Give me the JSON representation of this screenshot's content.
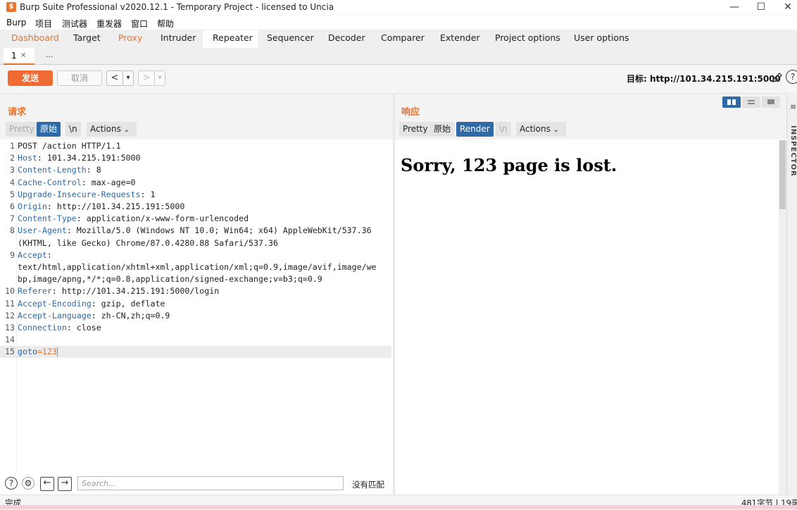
{
  "window": {
    "title": "Burp Suite Professional v2020.12.1 - Temporary Project - licensed to Uncia",
    "app_icon": "$"
  },
  "menu": [
    "Burp",
    "项目",
    "测试器",
    "重发器",
    "窗口",
    "帮助"
  ],
  "tabs": [
    {
      "label": "Dashboard",
      "state": "highlight"
    },
    {
      "label": "Target",
      "state": "normal"
    },
    {
      "label": "Proxy",
      "state": "highlight"
    },
    {
      "label": "Intruder",
      "state": "normal"
    },
    {
      "label": "Repeater",
      "state": "active"
    },
    {
      "label": "Sequencer",
      "state": "normal"
    },
    {
      "label": "Decoder",
      "state": "normal"
    },
    {
      "label": "Comparer",
      "state": "normal"
    },
    {
      "label": "Extender",
      "state": "normal"
    },
    {
      "label": "Project options",
      "state": "normal"
    },
    {
      "label": "User options",
      "state": "normal"
    }
  ],
  "subtabs": {
    "first": "1",
    "close": "×",
    "more": "..."
  },
  "toolbar": {
    "send": "发送",
    "cancel": "取消",
    "back": "<",
    "forward": ">",
    "dropdown": "▾",
    "target": "目标: http://101.34.215.191:5000"
  },
  "request": {
    "title": "请求",
    "buttons": {
      "pretty": "Pretty",
      "raw": "原始",
      "newline": "\\n",
      "actions": "Actions"
    },
    "lines": [
      {
        "n": "1",
        "key": "",
        "val": "POST /action HTTP/1.1"
      },
      {
        "n": "2",
        "key": "Host",
        "val": ": 101.34.215.191:5000"
      },
      {
        "n": "3",
        "key": "Content-Length",
        "val": ": 8"
      },
      {
        "n": "4",
        "key": "Cache-Control",
        "val": ": max-age=0"
      },
      {
        "n": "5",
        "key": "Upgrade-Insecure-Requests",
        "val": ": 1"
      },
      {
        "n": "6",
        "key": "Origin",
        "val": ": http://101.34.215.191:5000"
      },
      {
        "n": "7",
        "key": "Content-Type",
        "val": ": application/x-www-form-urlencoded"
      },
      {
        "n": "8",
        "key": "User-Agent",
        "val": ": Mozilla/5.0 (Windows NT 10.0; Win64; x64) AppleWebKit/537.36"
      },
      {
        "n": "",
        "key": "",
        "val": "(KHTML, like Gecko) Chrome/87.0.4280.88 Safari/537.36"
      },
      {
        "n": "9",
        "key": "Accept",
        "val": ":"
      },
      {
        "n": "",
        "key": "",
        "val": "text/html,application/xhtml+xml,application/xml;q=0.9,image/avif,image/we"
      },
      {
        "n": "",
        "key": "",
        "val": "bp,image/apng,*/*;q=0.8,application/signed-exchange;v=b3;q=0.9"
      },
      {
        "n": "10",
        "key": "Referer",
        "val": ": http://101.34.215.191:5000/login"
      },
      {
        "n": "11",
        "key": "Accept-Encoding",
        "val": ": gzip, deflate"
      },
      {
        "n": "12",
        "key": "Accept-Language",
        "val": ": zh-CN,zh;q=0.9"
      },
      {
        "n": "13",
        "key": "Connection",
        "val": ": close"
      },
      {
        "n": "14",
        "key": "",
        "val": ""
      },
      {
        "n": "15",
        "key": "goto",
        "val": "=123",
        "body": true
      }
    ]
  },
  "response": {
    "title": "响应",
    "buttons": {
      "pretty": "Pretty",
      "raw": "原始",
      "render": "Render",
      "newline": "\\n",
      "actions": "Actions"
    },
    "rendered_text": "Sorry, 123 page is lost."
  },
  "inspector": {
    "label": "INSPECTOR"
  },
  "search": {
    "placeholder": "Search...",
    "no_match": "没有匹配"
  },
  "status": {
    "left": "完成",
    "right": "481字节 | 19毫"
  },
  "colors": {
    "accent": "#e8732c",
    "selected": "#2e6aa8",
    "send": "#ef6b33"
  }
}
